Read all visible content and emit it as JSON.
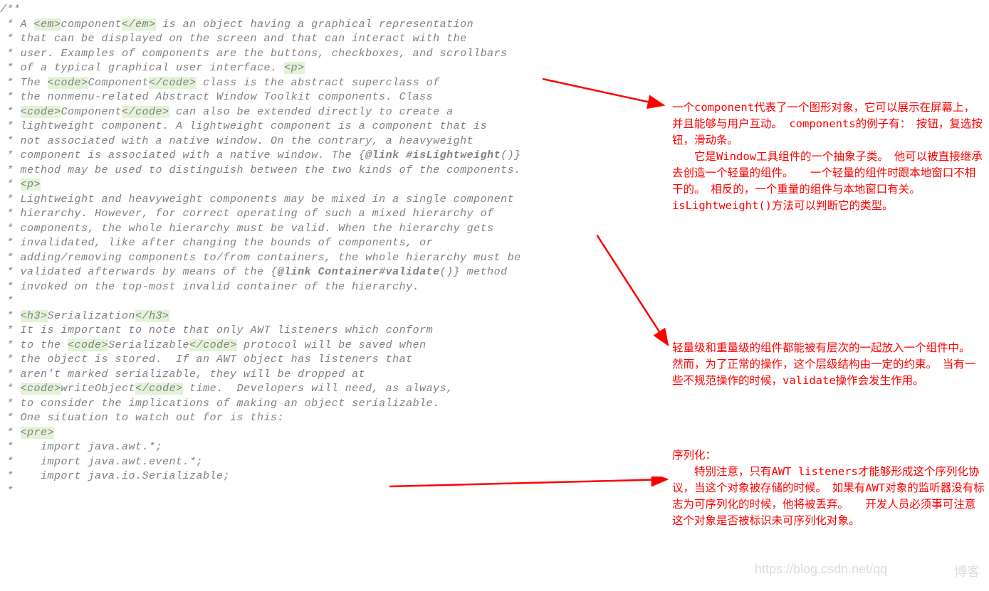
{
  "code": {
    "l0": "/**",
    "l1": " * A ",
    "l1_hl1": "<em>",
    "l1b": "component",
    "l1_hl2": "</em>",
    "l1c": " is an object having a graphical representation",
    "l2": " * that can be displayed on the screen and that can interact with the",
    "l3": " * user. Examples of components are the buttons, checkboxes, and scrollbars",
    "l4": " * of a typical graphical user interface. ",
    "l4_hl": "<p>",
    "l5": " * The ",
    "l5_hl1": "<code>",
    "l5b": "Component",
    "l5_hl2": "</code>",
    "l5c": " class is the abstract superclass of",
    "l6": " * the nonmenu-related Abstract Window Toolkit components. Class",
    "l7": " * ",
    "l7_hl1": "<code>",
    "l7b": "Component",
    "l7_hl2": "</code>",
    "l7c": " can also be extended directly to create a",
    "l8": " * lightweight component. A lightweight component is a component that is",
    "l9": " * not associated with a native window. On the contrary, a heavyweight",
    "l10": " * component is associated with a native window. The {",
    "l10_b1": "@link ",
    "l10_b2": "#isLightweight",
    "l10c": "()}",
    "l11": " * method may be used to distinguish between the two kinds of the components.",
    "l12": " * ",
    "l12_hl": "<p>",
    "l13": " * Lightweight and heavyweight components may be mixed in a single component",
    "l14": " * hierarchy. However, for correct operating of such a mixed hierarchy of",
    "l15": " * components, the whole hierarchy must be valid. When the hierarchy gets",
    "l16": " * invalidated, like after changing the bounds of components, or",
    "l17": " * adding/removing components to/from containers, the whole hierarchy must be",
    "l18": " * validated afterwards by means of the {",
    "l18_b1": "@link ",
    "l18_b2": "Container#validate",
    "l18c": "()} method",
    "l19": " * invoked on the top-most invalid container of the hierarchy.",
    "l20": " *",
    "l21": " * ",
    "l21_hl1": "<h3>",
    "l21b": "Serialization",
    "l21_hl2": "</h3>",
    "l22": " * It is important to note that only AWT listeners which conform",
    "l23": " * to the ",
    "l23_hl1": "<code>",
    "l23b": "Serializable",
    "l23_hl2": "</code>",
    "l23c": " protocol will be saved when",
    "l24": " * the object is stored.  If an AWT object has listeners that",
    "l25": " * aren't marked serializable, they will be dropped at",
    "l26": " * ",
    "l26_hl1": "<code>",
    "l26b": "writeObject",
    "l26_hl2": "</code>",
    "l26c": " time.  Developers will need, as always,",
    "l27": " * to consider the implications of making an object serializable.",
    "l28": " * One situation to watch out for is this:",
    "l29": " * ",
    "l29_hl": "<pre>",
    "l30": " *    import java.awt.*;",
    "l31": " *    import java.awt.event.*;",
    "l32": " *    import java.io.Serializable;",
    "l33": " *"
  },
  "anno1": "一个component代表了一个图形对象，它可以展示在屏幕上，并且能够与用户互动。 components的例子有：　按钮，复选按钮，滑动条。\n　　它是Window工具组件的一个抽象子类。　他可以被直接继承去创造一个轻量的组件。　　一个轻量的组件时跟本地窗口不相干的。　相反的，一个重量的组件与本地窗口有关。 isLightweight()方法可以判断它的类型。",
  "anno2": "轻量级和重量级的组件都能被有层次的一起放入一个组件中。　然而，为了正常的操作，这个层级结构由一定的约束。　当有一些不规范操作的时候，validate操作会发生作用。",
  "anno3_title": "序列化：",
  "anno3": "　　特别注意，只有AWT listeners才能够形成这个序列化协议，当这个对象被存储的时候。　如果有AWT对象的监听器没有标志为可序列化的时候，他将被丢弃。　　开发人员必须事可注意这个对象是否被标识未可序列化对象。",
  "watermark1": "https://blog.csdn.net/qq",
  "watermark2": "博客"
}
